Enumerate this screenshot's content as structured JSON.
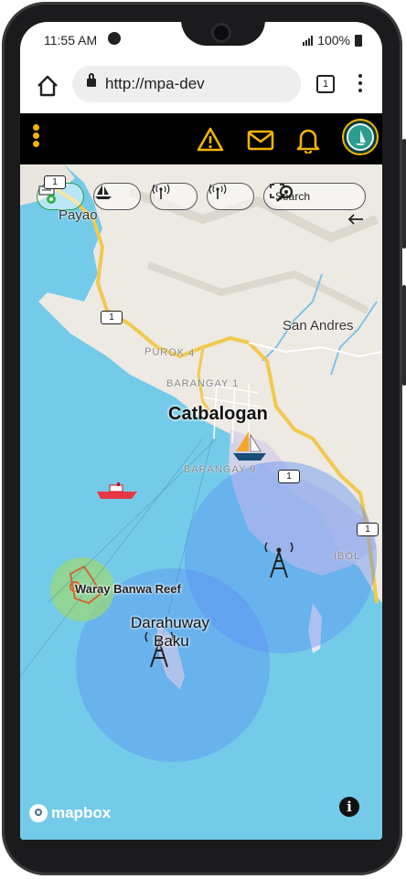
{
  "status_bar": {
    "time": "11:55 AM",
    "battery": "100%"
  },
  "browser": {
    "url": "http://mpa-dev",
    "tab_count": "1"
  },
  "app_bar": {
    "menu_icon": "vertical-dots-icon",
    "icons": [
      "warning-icon",
      "mail-icon",
      "bell-icon"
    ],
    "accent_color": "#f4b400"
  },
  "map_controls": {
    "search_label": "Search",
    "buttons": [
      "layers-toggle",
      "vessel-filter",
      "tower-filter-1",
      "tower-filter-2"
    ]
  },
  "map": {
    "places": {
      "payao": "Payao",
      "san_andres": "San Andres",
      "purok": "PUROK 4",
      "barangay1": "BARANGAY 1",
      "city": "Catbalogan",
      "barangay9": "BARANGAY 9",
      "ibol": "IBOL",
      "reef": "Waray Banwa Reef",
      "island_line1": "Darahuway",
      "island_line2": "Baku"
    },
    "road_shields": [
      "1",
      "1",
      "1",
      "1"
    ],
    "colors": {
      "water": "#73cbe9",
      "land": "#ede9e3",
      "road": "#f2c94c",
      "coverage": "#5a8ef2"
    }
  },
  "attribution": {
    "brand": "mapbox",
    "info_icon": "info-icon"
  }
}
